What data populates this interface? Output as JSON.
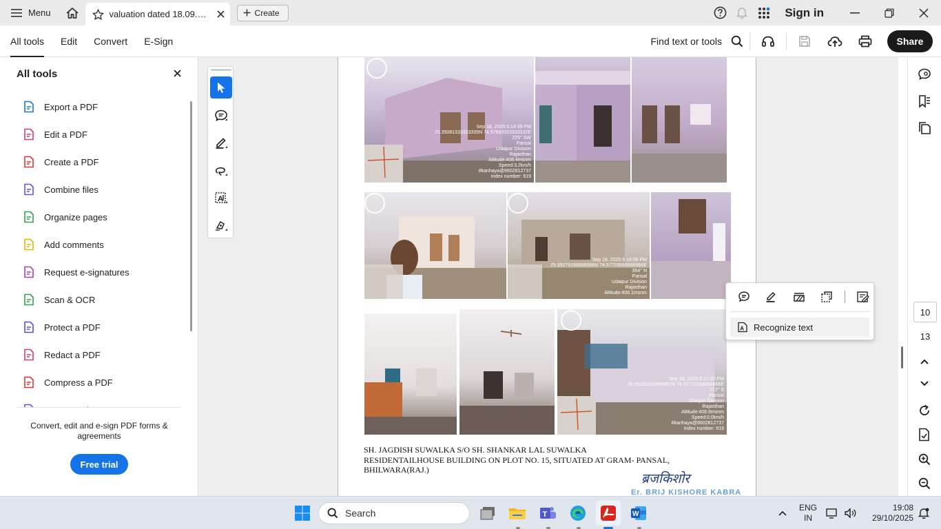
{
  "titlebar": {
    "menu_label": "Menu",
    "tab_title": "valuation dated 18.09.20...",
    "create_label": "Create",
    "signin_label": "Sign in"
  },
  "toolbar": {
    "tabs": [
      "All tools",
      "Edit",
      "Convert",
      "E-Sign"
    ],
    "find_label": "Find text or tools",
    "share_label": "Share"
  },
  "left_panel": {
    "title": "All tools",
    "tools": [
      {
        "label": "Export a PDF",
        "icon": "export-pdf-icon",
        "color": "#1473e6"
      },
      {
        "label": "Edit a PDF",
        "icon": "edit-pdf-icon",
        "color": "#d6387a"
      },
      {
        "label": "Create a PDF",
        "icon": "create-pdf-icon",
        "color": "#e0342f"
      },
      {
        "label": "Combine files",
        "icon": "combine-files-icon",
        "color": "#6b4ee6"
      },
      {
        "label": "Organize pages",
        "icon": "organize-pages-icon",
        "color": "#2da44e"
      },
      {
        "label": "Add comments",
        "icon": "add-comments-icon",
        "color": "#e6b800"
      },
      {
        "label": "Request e-signatures",
        "icon": "request-esignatures-icon",
        "color": "#b03ab3"
      },
      {
        "label": "Scan & OCR",
        "icon": "scan-ocr-icon",
        "color": "#2da44e"
      },
      {
        "label": "Protect a PDF",
        "icon": "protect-pdf-icon",
        "color": "#5b4ae0"
      },
      {
        "label": "Redact a PDF",
        "icon": "redact-pdf-icon",
        "color": "#d6387a"
      },
      {
        "label": "Compress a PDF",
        "icon": "compress-pdf-icon",
        "color": "#e0342f"
      },
      {
        "label": "Prepare a form",
        "icon": "prepare-form-icon",
        "color": "#6b4ee6"
      }
    ],
    "promo_text": "Convert, edit and e-sign PDF forms & agreements",
    "free_trial_label": "Free trial"
  },
  "document": {
    "photo_stamps": [
      [
        "Sep 18, 2025 6:14:39 PM",
        "25.35081333333335N 74.57693333333332E",
        "229° SW",
        "Pansal",
        "Udaipur Division",
        "Rajasthan",
        "Altitude:406.4msnm",
        "Speed:3.2km/h",
        "#kanhaya@9602812737",
        "Index number: 619"
      ],
      [
        "Sep 18, 2025 6:14:56 PM",
        "25.35079166666666N 74.57703666666666E",
        "354° N",
        "Pansal",
        "Udaipur Division",
        "Rajasthan",
        "Altitude:406.1msnm"
      ],
      [
        "Sep 18, 2025 6:17:20 PM",
        "25.35100166666667N 74.57710166666666E",
        "172° S",
        "Pansal",
        "Udaipur Division",
        "Rajasthan",
        "Altitude:406.9msnm",
        "Speed:0.0km/h",
        "#kanhaya@9602812737",
        "Index number: 619"
      ]
    ],
    "caption_lines": [
      "SH. JAGDISH SUWALKA S/O SH. SHANKAR LAL SUWALKA",
      "RESIDENTAILHOUSE BUILDING ON PLOT NO. 15,  SITUATED AT GRAM- PANSAL,",
      "BHILWARA(RAJ.)"
    ],
    "signature_text": "ब्रजकिशोर",
    "signature_name": "Er. BRIJ KISHORE KABRA"
  },
  "context_menu": {
    "item_label": "Recognize text"
  },
  "page_nav": {
    "current_page": "10",
    "total_pages": "13"
  },
  "taskbar": {
    "search_placeholder": "Search",
    "lang_line1": "ENG",
    "lang_line2": "IN",
    "time": "19:08",
    "date": "29/10/2025"
  },
  "colors": {
    "accent": "#1473e6",
    "share_bg": "#1a1a1a",
    "titlebar_bg": "#eaeaea",
    "taskbar_bg": "#dfe6ee"
  }
}
